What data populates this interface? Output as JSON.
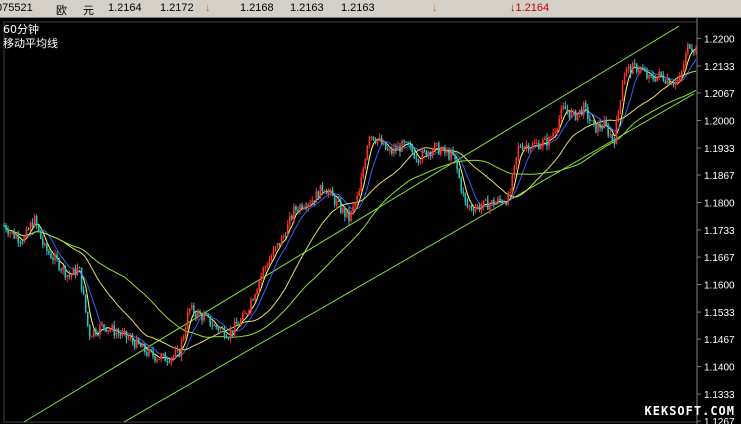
{
  "header": {
    "code": "075521",
    "name_part1": "欧",
    "name_part2": "元",
    "price1": "1.2164",
    "price2": "1.2172",
    "arrow1": "↓",
    "price3": "1.2168",
    "price4": "1.2163",
    "price5": "1.2163",
    "arrow2": "↓",
    "last": "↓1.2164"
  },
  "chart_data": {
    "type": "candlestick",
    "title": "60分钟",
    "subtitle": "移动平均线",
    "ylim": [
      1.1265,
      1.224
    ],
    "y_ticks": [
      "1.2200",
      "1.2133",
      "1.2067",
      "1.2000",
      "1.1933",
      "1.1867",
      "1.1800",
      "1.1733",
      "1.1667",
      "1.1600",
      "1.1533",
      "1.1467",
      "1.1400",
      "1.1333",
      "1.1267"
    ],
    "bar_count": 340,
    "price_path": [
      [
        0,
        1.1745
      ],
      [
        10,
        1.172
      ],
      [
        20,
        1.171
      ],
      [
        30,
        1.176
      ],
      [
        40,
        1.169
      ],
      [
        55,
        1.165
      ],
      [
        65,
        1.162
      ],
      [
        75,
        1.164
      ],
      [
        85,
        1.148
      ],
      [
        100,
        1.15
      ],
      [
        115,
        1.148
      ],
      [
        130,
        1.146
      ],
      [
        145,
        1.143
      ],
      [
        160,
        1.142
      ],
      [
        175,
        1.143
      ],
      [
        185,
        1.154
      ],
      [
        200,
        1.152
      ],
      [
        210,
        1.15
      ],
      [
        225,
        1.148
      ],
      [
        240,
        1.152
      ],
      [
        250,
        1.158
      ],
      [
        260,
        1.164
      ],
      [
        270,
        1.168
      ],
      [
        280,
        1.172
      ],
      [
        290,
        1.178
      ],
      [
        300,
        1.18
      ],
      [
        310,
        1.181
      ],
      [
        320,
        1.184
      ],
      [
        335,
        1.179
      ],
      [
        345,
        1.176
      ],
      [
        355,
        1.182
      ],
      [
        365,
        1.197
      ],
      [
        375,
        1.195
      ],
      [
        385,
        1.192
      ],
      [
        400,
        1.194
      ],
      [
        415,
        1.191
      ],
      [
        430,
        1.1935
      ],
      [
        450,
        1.191
      ],
      [
        462,
        1.179
      ],
      [
        475,
        1.179
      ],
      [
        490,
        1.18
      ],
      [
        505,
        1.181
      ],
      [
        515,
        1.194
      ],
      [
        530,
        1.194
      ],
      [
        545,
        1.195
      ],
      [
        560,
        1.203
      ],
      [
        570,
        1.201
      ],
      [
        580,
        1.203
      ],
      [
        590,
        1.198
      ],
      [
        600,
        1.199
      ],
      [
        610,
        1.195
      ],
      [
        620,
        1.212
      ],
      [
        635,
        1.213
      ],
      [
        645,
        1.21
      ],
      [
        655,
        1.211
      ],
      [
        665,
        1.21
      ],
      [
        675,
        1.209
      ],
      [
        685,
        1.219
      ],
      [
        692,
        1.2172
      ]
    ],
    "ma_series": [
      {
        "color": "#ffff60",
        "period": 5
      },
      {
        "color": "#3060ff",
        "period": 10
      },
      {
        "color": "#e0e060",
        "period": 30
      },
      {
        "color": "#90e030",
        "period": 60
      }
    ],
    "channel_lines": [
      {
        "x": [
          20,
          675
        ],
        "y": [
          1.1265,
          1.223
        ]
      },
      {
        "x": [
          120,
          690
        ],
        "y": [
          1.1265,
          1.2065
        ]
      }
    ],
    "colors": {
      "up": "#ff3030",
      "down": "#30c0c0",
      "grid": "#5a5a5a",
      "axis_text": "#ffffff"
    }
  },
  "watermark": "KEKSOFT.COM"
}
